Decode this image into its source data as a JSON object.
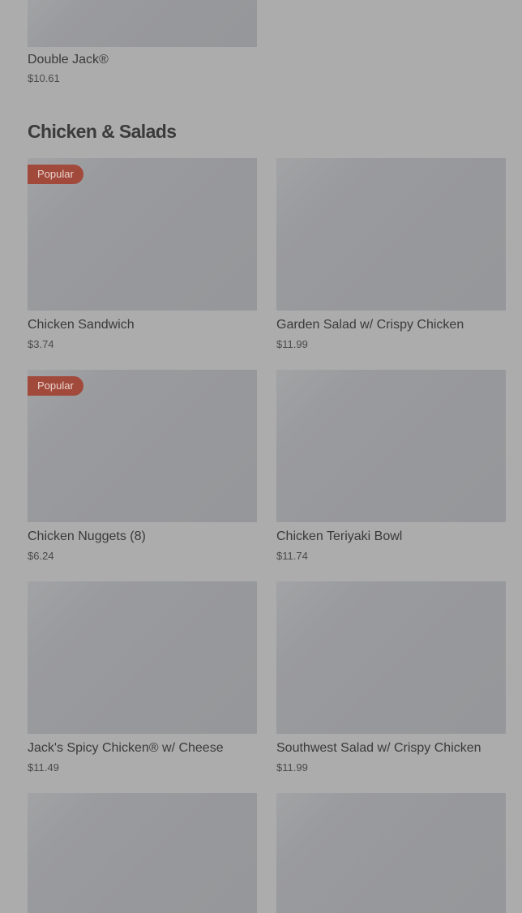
{
  "previous_section": {
    "item": {
      "name": "Double Jack®",
      "price": "$10.61"
    }
  },
  "section": {
    "title": "Chicken & Salads",
    "items": [
      {
        "name": "Chicken Sandwich",
        "price": "$3.74",
        "badge": "Popular"
      },
      {
        "name": "Garden Salad w/ Crispy Chicken",
        "price": "$11.99"
      },
      {
        "name": "Chicken Nuggets (8)",
        "price": "$6.24",
        "badge": "Popular"
      },
      {
        "name": "Chicken Teriyaki Bowl",
        "price": "$11.74"
      },
      {
        "name": "Jack's Spicy Chicken® w/ Cheese",
        "price": "$11.49"
      },
      {
        "name": "Southwest Salad w/ Crispy Chicken",
        "price": "$11.99"
      }
    ]
  },
  "colors": {
    "page_background": "#acacac",
    "image_placeholder": "#97989b",
    "badge_background": "#a14a3c",
    "badge_text": "#e9d2cd"
  }
}
